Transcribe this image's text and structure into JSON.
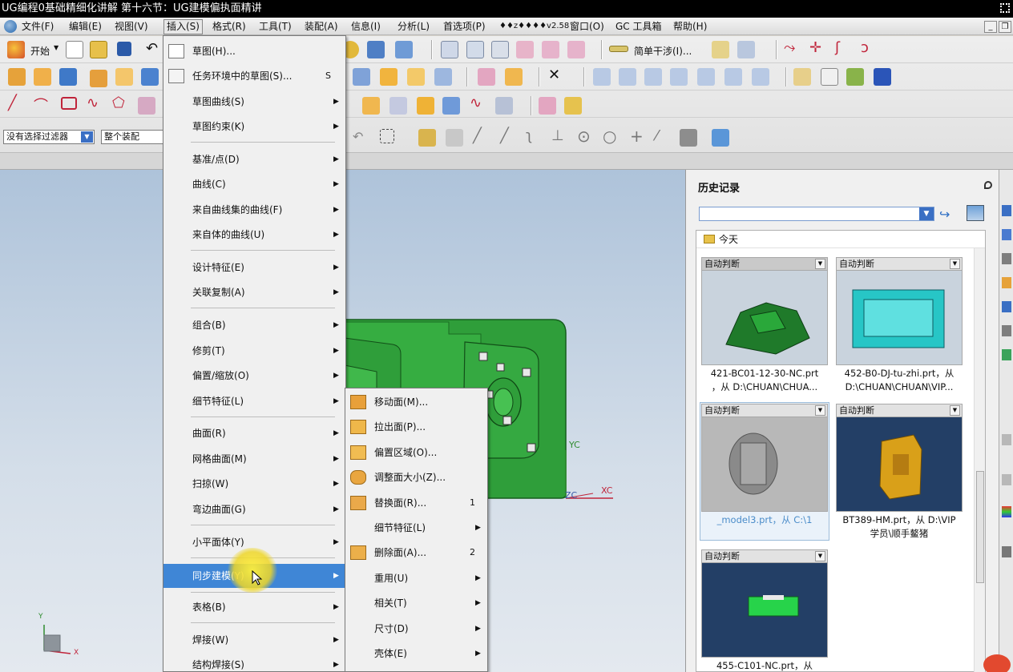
{
  "titlebar": {
    "text": "UG编程0基础精细化讲解 第十六节：UG建模偏执面精讲"
  },
  "menubar": {
    "items": [
      {
        "label": "文件(F)",
        "active": false
      },
      {
        "label": "编辑(E)",
        "active": false
      },
      {
        "label": "视图(V)",
        "active": false
      },
      {
        "label": "插入(S)",
        "active": true
      },
      {
        "label": "格式(R)",
        "active": false
      },
      {
        "label": "工具(T)",
        "active": false
      },
      {
        "label": "装配(A)",
        "active": false
      },
      {
        "label": "信息(I)",
        "active": false
      },
      {
        "label": "分析(L)",
        "active": false
      },
      {
        "label": "首选项(P)",
        "active": false
      },
      {
        "label": "♦♦z♦♦♦♦v2.58",
        "active": false
      },
      {
        "label": "窗口(O)",
        "active": false
      },
      {
        "label": "GC 工具箱",
        "active": false
      },
      {
        "label": "帮助(H)",
        "active": false
      }
    ]
  },
  "toolbar": {
    "start_label": "开始",
    "simple_interference_label": "简单干涉(I)...",
    "selection_filter": "没有选择过滤器",
    "assembly_scope": "整个装配"
  },
  "insert_menu": {
    "items": [
      {
        "label": "草图(H)...",
        "accel": "",
        "submenu": false,
        "icon": "sketch-icon"
      },
      {
        "label": "任务环境中的草图(S)...",
        "accel": "S",
        "submenu": false,
        "icon": "task-sketch-icon"
      },
      {
        "label": "草图曲线(S)",
        "accel": "",
        "submenu": true
      },
      {
        "label": "草图约束(K)",
        "accel": "",
        "submenu": true
      },
      {
        "sep": true
      },
      {
        "label": "基准/点(D)",
        "accel": "",
        "submenu": true
      },
      {
        "label": "曲线(C)",
        "accel": "",
        "submenu": true
      },
      {
        "label": "来自曲线集的曲线(F)",
        "accel": "",
        "submenu": true
      },
      {
        "label": "来自体的曲线(U)",
        "accel": "",
        "submenu": true
      },
      {
        "sep": true
      },
      {
        "label": "设计特征(E)",
        "accel": "",
        "submenu": true
      },
      {
        "label": "关联复制(A)",
        "accel": "",
        "submenu": true
      },
      {
        "sep": true
      },
      {
        "label": "组合(B)",
        "accel": "",
        "submenu": true
      },
      {
        "label": "修剪(T)",
        "accel": "",
        "submenu": true
      },
      {
        "label": "偏置/缩放(O)",
        "accel": "",
        "submenu": true
      },
      {
        "label": "细节特征(L)",
        "accel": "",
        "submenu": true
      },
      {
        "sep": true
      },
      {
        "label": "曲面(R)",
        "accel": "",
        "submenu": true
      },
      {
        "label": "网格曲面(M)",
        "accel": "",
        "submenu": true
      },
      {
        "label": "扫掠(W)",
        "accel": "",
        "submenu": true
      },
      {
        "label": "弯边曲面(G)",
        "accel": "",
        "submenu": true
      },
      {
        "sep": true
      },
      {
        "label": "小平面体(Y)",
        "accel": "",
        "submenu": true
      },
      {
        "sep": true
      },
      {
        "label": "同步建模(Y)",
        "accel": "",
        "submenu": true,
        "highlighted": true
      },
      {
        "sep": true
      },
      {
        "label": "表格(B)",
        "accel": "",
        "submenu": true
      },
      {
        "sep": true
      },
      {
        "label": "焊接(W)",
        "accel": "",
        "submenu": true
      },
      {
        "label": "结构焊接(S)",
        "accel": "",
        "submenu": true
      }
    ]
  },
  "sync_menu": {
    "items": [
      {
        "label": "移动面(M)...",
        "accel": "",
        "submenu": false,
        "icon": "move-face-icon"
      },
      {
        "label": "拉出面(P)...",
        "accel": "",
        "submenu": false,
        "icon": "pull-face-icon"
      },
      {
        "label": "偏置区域(O)...",
        "accel": "",
        "submenu": false,
        "icon": "offset-region-icon"
      },
      {
        "label": "调整面大小(Z)...",
        "accel": "",
        "submenu": false,
        "icon": "resize-face-icon"
      },
      {
        "label": "替换面(R)...",
        "accel": "1",
        "submenu": false,
        "icon": "replace-face-icon"
      },
      {
        "label": "细节特征(L)",
        "accel": "",
        "submenu": true
      },
      {
        "label": "删除面(A)...",
        "accel": "2",
        "submenu": false,
        "icon": "delete-face-icon"
      },
      {
        "label": "重用(U)",
        "accel": "",
        "submenu": true
      },
      {
        "label": "相关(T)",
        "accel": "",
        "submenu": true
      },
      {
        "label": "尺寸(D)",
        "accel": "",
        "submenu": true
      },
      {
        "label": "壳体(E)",
        "accel": "",
        "submenu": true
      }
    ]
  },
  "viewport": {
    "axis_yc": "YC",
    "axis_xc": "XC",
    "axis_zc": "ZC",
    "triad_y": "Y",
    "triad_x": "X"
  },
  "history": {
    "title": "历史记录",
    "group": "今天",
    "cards": [
      {
        "header": "自动判断",
        "caption_lines": [
          "421-BC01-12-30-NC.prt",
          "，从 D:\\CHUAN\\CHUA..."
        ],
        "color": "#1f7a2a",
        "bg": "#c9d3dd"
      },
      {
        "header": "自动判断",
        "caption_lines": [
          "452-B0-DJ-tu-zhi.prt，从",
          "D:\\CHUAN\\CHUAN\\VIP..."
        ],
        "color": "#27c6c6",
        "bg": "#c9d3dd"
      },
      {
        "header": "自动判断",
        "caption_lines": [
          "_model3.prt，从 C:\\1"
        ],
        "color": "#8a8a8a",
        "bg": "#b8b8b8"
      },
      {
        "header": "自动判断",
        "caption_lines": [
          "BT389-HM.prt，从 D:\\VIP",
          "学员\\顺手鳌猪"
        ],
        "color": "#d9a019",
        "bg": "#233f66"
      },
      {
        "header": "自动判断",
        "caption_lines": [
          "455-C101-NC.prt，从"
        ],
        "color": "#27d34a",
        "bg": "#233f66"
      }
    ]
  },
  "colors": {
    "menu_highlight": "#3f86d6",
    "model_green": "#2f9e3a",
    "viewport_top": "#aec3da"
  }
}
